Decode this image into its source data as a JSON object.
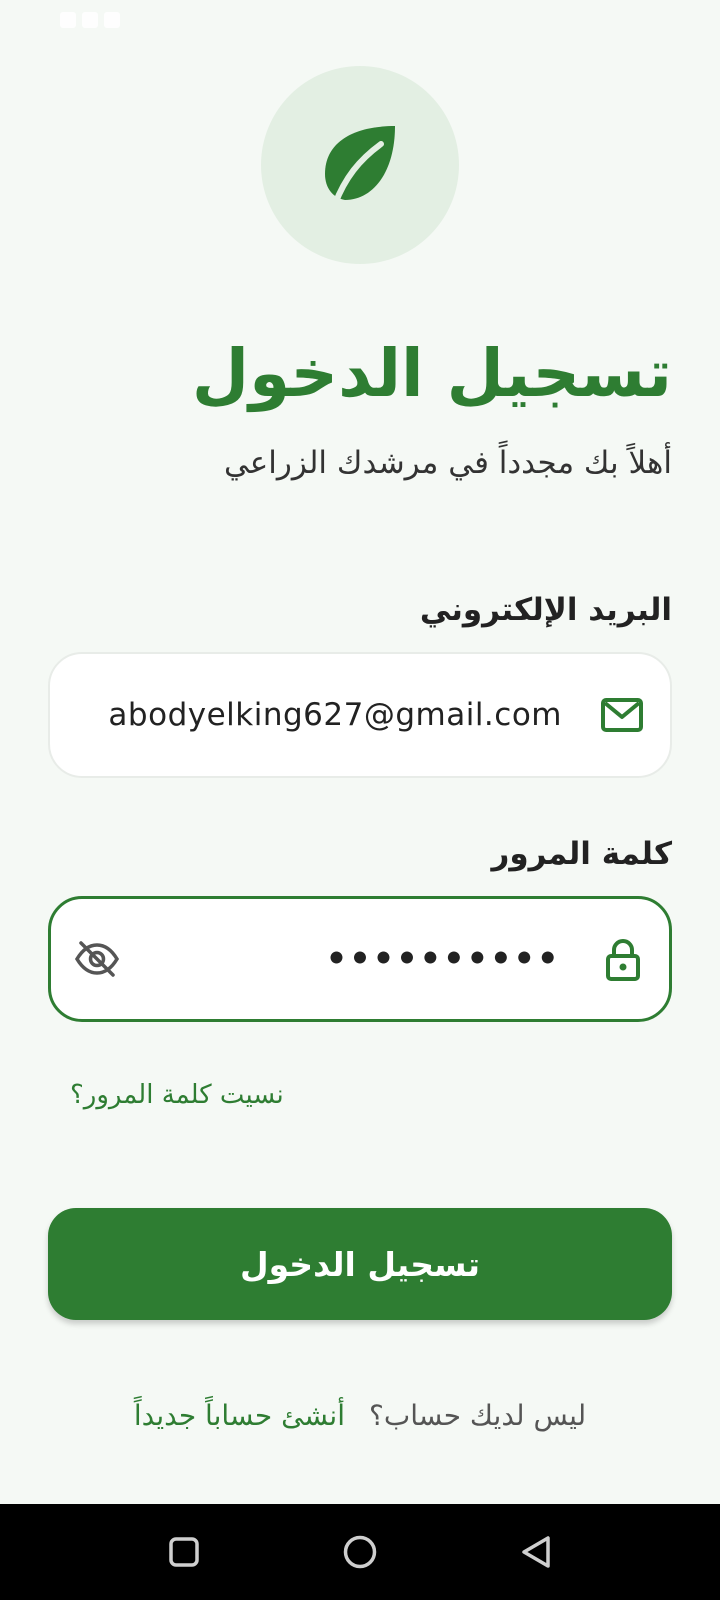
{
  "header": {
    "title": "تسجيل الدخول",
    "subtitle": "أهلاً بك مجدداً في مرشدك الزراعي"
  },
  "form": {
    "email": {
      "label": "البريد الإلكتروني",
      "value": "abodyelking627@gmail.com",
      "icon": "mail-icon"
    },
    "password": {
      "label": "كلمة المرور",
      "value": "••••••••••",
      "icon": "lock-icon",
      "toggle_icon": "eye-off-icon"
    },
    "forgot_password": "نسيت كلمة المرور؟",
    "submit_label": "تسجيل الدخول"
  },
  "signup": {
    "prompt": "ليس لديك حساب؟",
    "link": "أنشئ حساباً جديداً"
  },
  "logo": {
    "icon": "leaf-icon"
  },
  "nav": {
    "recents_icon": "square-icon",
    "home_icon": "circle-icon",
    "back_icon": "triangle-back-icon"
  },
  "colors": {
    "primary": "#2e7d32",
    "background": "#f5f9f5",
    "logo_circle": "#e3efe3",
    "text": "#222222",
    "nav_bar": "#000000"
  }
}
